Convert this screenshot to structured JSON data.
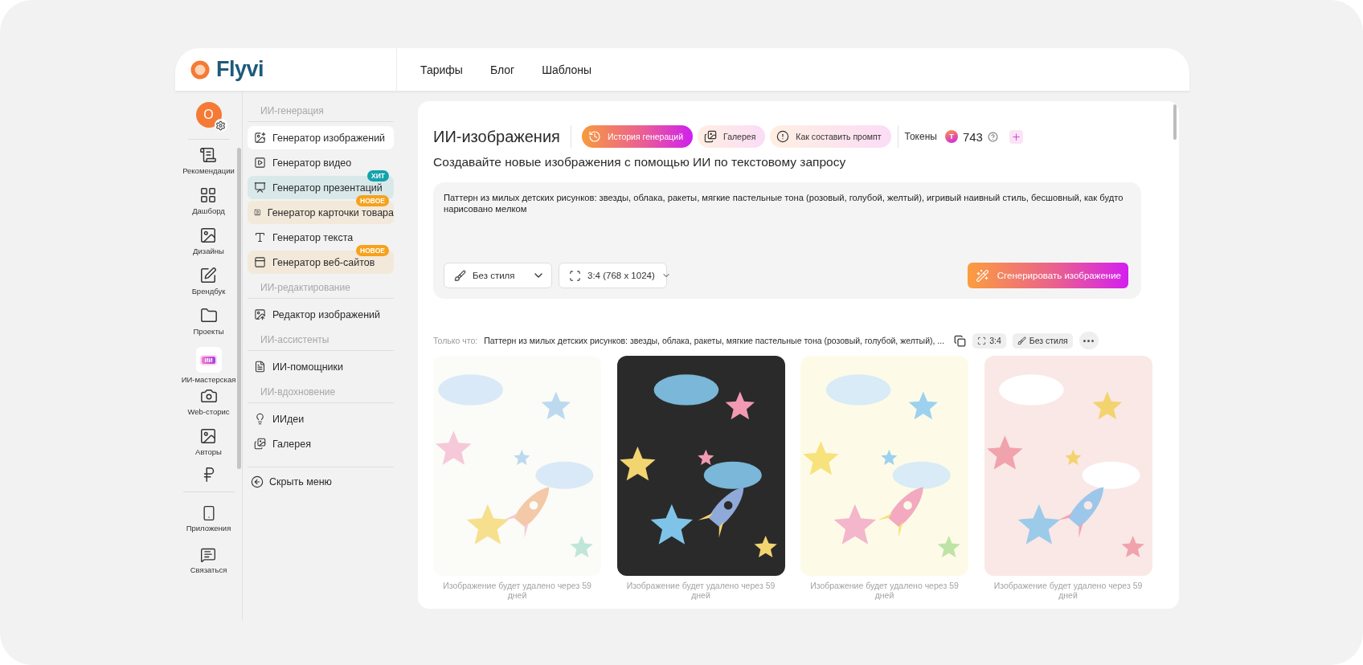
{
  "header": {
    "logo": "Flyvi",
    "nav": [
      "Тарифы",
      "Блог",
      "Шаблоны"
    ]
  },
  "rail": {
    "avatar": "O",
    "items": [
      {
        "kind": "icon",
        "label": "Рекомендации"
      },
      {
        "kind": "icon",
        "label": "Дашборд"
      },
      {
        "kind": "icon",
        "label": "Дизайны"
      },
      {
        "kind": "icon",
        "label": "Брендбук"
      },
      {
        "kind": "icon",
        "label": "Проекты"
      },
      {
        "kind": "tile",
        "label": "ИИ-мастерская",
        "tile_text": "ИИ"
      },
      {
        "kind": "icon",
        "label": "Web-сторис"
      },
      {
        "kind": "icon",
        "label": "Авторы"
      }
    ],
    "bottom_items": [
      {
        "label": "Приложения"
      },
      {
        "label": "Связаться"
      }
    ]
  },
  "menu": {
    "sections": [
      {
        "heading": "ИИ-генерация",
        "items": [
          {
            "label": "Генератор изображений",
            "selected": true
          },
          {
            "label": "Генератор видео",
            "selected": false
          },
          {
            "label": "Генератор презентаций",
            "selected": false,
            "badge": "ХИТ",
            "color": "#14a3ab"
          },
          {
            "label": "Генератор карточки товара",
            "selected": false,
            "badge": "НОВОЕ",
            "color": "#f7a21b"
          },
          {
            "label": "Генератор текста",
            "selected": false
          },
          {
            "label": "Генератор веб-сайтов",
            "selected": false,
            "badge": "НОВОЕ",
            "color": "#f7a21b"
          }
        ]
      },
      {
        "heading": "ИИ-редактирование",
        "items": [
          {
            "label": "Редактор изображений",
            "selected": false
          }
        ]
      },
      {
        "heading": "ИИ-ассистенты",
        "items": [
          {
            "label": "ИИ-помощники",
            "selected": false
          }
        ]
      },
      {
        "heading": "ИИ-вдохновение",
        "items": [
          {
            "label": "ИИдеи",
            "selected": false
          },
          {
            "label": "Галерея",
            "selected": false
          }
        ]
      }
    ],
    "collapse": "Скрыть меню"
  },
  "main": {
    "title": "ИИ-изображения",
    "chips": [
      {
        "label": "История генераций",
        "selected": true
      },
      {
        "label": "Галерея",
        "selected": false
      },
      {
        "label": "Как составить промпт",
        "selected": false
      }
    ],
    "tokens": {
      "label": "Токены",
      "coin": "T",
      "count": "743"
    },
    "subtitle": "Создавайте новые изображения с помощью ИИ по текстовому запросу",
    "prompt": "Паттерн из милых детских рисунков: звезды, облака, ракеты, мягкие пастельные тона (розовый, голубой, желтый), игривый наивный стиль, бесшовный, как будто нарисовано мелком",
    "style_select": "Без стиля",
    "size_select": "3:4 (768 x 1024)",
    "generate": "Сгенерировать изображение",
    "recent": {
      "label": "Только что:",
      "prompt": "Паттерн из милых детских рисунков: звезды, облака, ракеты, мягкие пастельные тона (розовый, голубой, желтый), ...",
      "ratio": "3:4",
      "style": "Без стиля"
    },
    "images": [
      {
        "caption": "Изображение будет удалено через 59 дней"
      },
      {
        "caption": "Изображение будет удалено через 59 дней"
      },
      {
        "caption": "Изображение будет удалено через 59 дней"
      },
      {
        "caption": "Изображение будет удалено через 59 дней"
      }
    ]
  }
}
